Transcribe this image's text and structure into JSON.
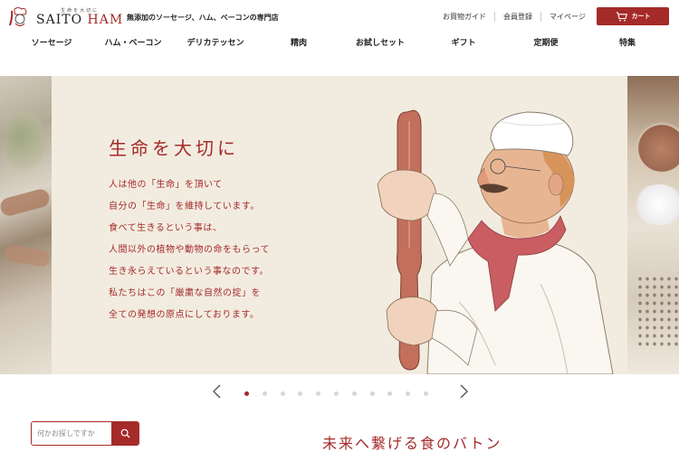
{
  "brand": {
    "logo_subtitle": "生命を大切に",
    "logo_saito": "SAITO ",
    "logo_ham": "HAM",
    "tagline": "無添加のソーセージ、ハム、ベーコンの専門店"
  },
  "utility_nav": [
    {
      "label": "お買物ガイド"
    },
    {
      "label": "会員登録"
    },
    {
      "label": "マイページ"
    }
  ],
  "cart": {
    "label": "カート",
    "icon": "cart-icon"
  },
  "main_nav": [
    {
      "label": "ソーセージ"
    },
    {
      "label": "ハム・ベーコン"
    },
    {
      "label": "デリカテッセン"
    },
    {
      "label": "精肉"
    },
    {
      "label": "お試しセット"
    },
    {
      "label": "ギフト"
    },
    {
      "label": "定期便"
    },
    {
      "label": "特集"
    }
  ],
  "hero": {
    "title": "生命を大切に",
    "lines": [
      "人は他の「生命」を頂いて",
      "自分の「生命」を維持しています。",
      "食べて生きるという事は、",
      "人間以外の植物や動物の命をもらって",
      "生き永らえているという事なのです。",
      "私たちはこの「厳粛な自然の掟」を",
      "全ての発想の原点にしております。"
    ]
  },
  "carousel": {
    "slide_count": 11,
    "active_index": 0
  },
  "search": {
    "placeholder": "何かお探しですか"
  },
  "section": {
    "title": "未来へ繋げる食のバトン"
  },
  "colors": {
    "accent": "#a52a2a",
    "hero_bg": "#f2ece0"
  }
}
